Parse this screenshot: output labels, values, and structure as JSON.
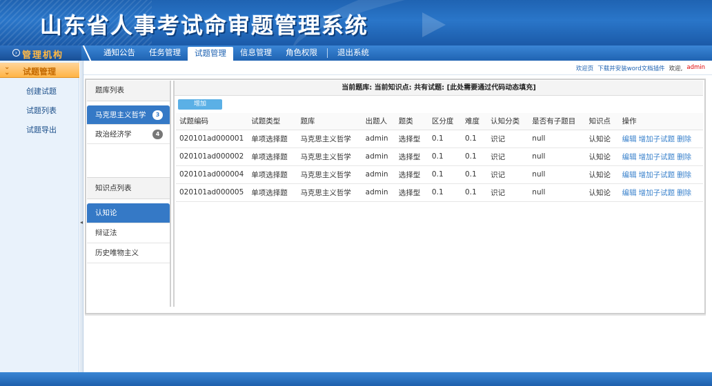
{
  "app": {
    "title": "山东省人事考试命审题管理系统"
  },
  "org": {
    "label": "管理机构"
  },
  "nav": {
    "items": [
      {
        "label": "通知公告"
      },
      {
        "label": "任务管理"
      },
      {
        "label": "试题管理"
      },
      {
        "label": "信息管理"
      },
      {
        "label": "角色权限"
      },
      {
        "label": "退出系统"
      }
    ],
    "active_index": 2
  },
  "sidebar": {
    "header": "试题管理",
    "items": [
      {
        "label": "创建试题"
      },
      {
        "label": "试题列表"
      },
      {
        "label": "试题导出"
      }
    ]
  },
  "topinfo": {
    "home": "欢迎页",
    "download": "下载并安装word文档插件",
    "welcome": "欢迎,",
    "user": "admin"
  },
  "left_panel": {
    "bank_header": "题库列表",
    "banks": [
      {
        "label": "马克思主义哲学",
        "count": "3"
      },
      {
        "label": "政治经济学",
        "count": "4"
      }
    ],
    "kp_header": "知识点列表",
    "knowledge_points": [
      {
        "label": "认知论"
      },
      {
        "label": "辩证法"
      },
      {
        "label": "历史唯物主义"
      }
    ]
  },
  "right_panel": {
    "header": "当前题库: 当前知识点: 共有试题: [此处需要通过代码动态填充]",
    "add_button": "增加",
    "columns": [
      "试题编码",
      "试题类型",
      "题库",
      "出题人",
      "题类",
      "区分度",
      "难度",
      "认知分类",
      "是否有子题目",
      "知识点",
      "操作"
    ],
    "rows": [
      [
        "020101ad000001",
        "单项选择题",
        "马克思主义哲学",
        "admin",
        "选择型",
        "0.1",
        "0.1",
        "识记",
        "null",
        "认知论"
      ],
      [
        "020101ad000002",
        "单项选择题",
        "马克思主义哲学",
        "admin",
        "选择型",
        "0.1",
        "0.1",
        "识记",
        "null",
        "认知论"
      ],
      [
        "020101ad000004",
        "单项选择题",
        "马克思主义哲学",
        "admin",
        "选择型",
        "0.1",
        "0.1",
        "识记",
        "null",
        "认知论"
      ],
      [
        "020101ad000005",
        "单项选择题",
        "马克思主义哲学",
        "admin",
        "选择型",
        "0.1",
        "0.1",
        "识记",
        "null",
        "认知论"
      ]
    ],
    "ops": [
      "编辑",
      "增加子试题",
      "删除"
    ]
  },
  "colors": {
    "brand_blue": "#1f63b2",
    "active_item": "#3579c6",
    "sidebar_accent": "#ffb445",
    "link": "#3a82cc",
    "user_red": "#e00000"
  }
}
